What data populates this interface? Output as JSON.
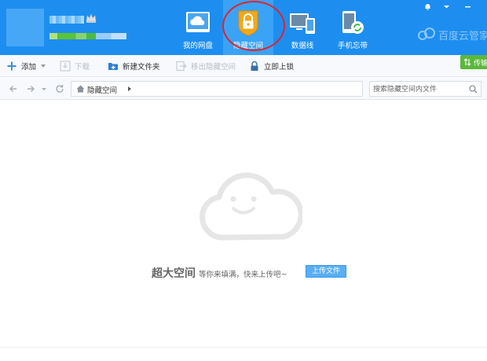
{
  "user": {
    "name": "",
    "vip_badge": "crown-icon"
  },
  "nav": [
    {
      "label": "我的网盘",
      "icon": "cloud-drive-icon",
      "active": false
    },
    {
      "label": "隐藏空间",
      "icon": "lock-shield-icon",
      "active": true
    },
    {
      "label": "数据线",
      "icon": "devices-icon",
      "active": false
    },
    {
      "label": "手机忘带",
      "icon": "phone-sync-icon",
      "active": false
    }
  ],
  "brand": {
    "name": "百度云管家"
  },
  "window_controls": [
    "bell-icon",
    "menu-icon",
    "minimize-icon"
  ],
  "toolbar": {
    "add": "添加",
    "download": "下载",
    "new_folder": "新建文件夹",
    "move_out": "移出隐藏空间",
    "lock_now": "立即上锁",
    "transfer": "传输"
  },
  "address": {
    "crumb": "隐藏空间",
    "search_placeholder": "搜索隐藏空间内文件"
  },
  "empty": {
    "title": "超大空间",
    "subtitle": "等你来填满，快来上传吧~",
    "upload_button": "上传文件"
  },
  "colors": {
    "header_bg": "#1d8ef0",
    "active_tab": "#3aa3f6",
    "highlight_ring": "#e0242c",
    "lock_icon": "#f2a818",
    "transfer_btn": "#5bb83a"
  }
}
